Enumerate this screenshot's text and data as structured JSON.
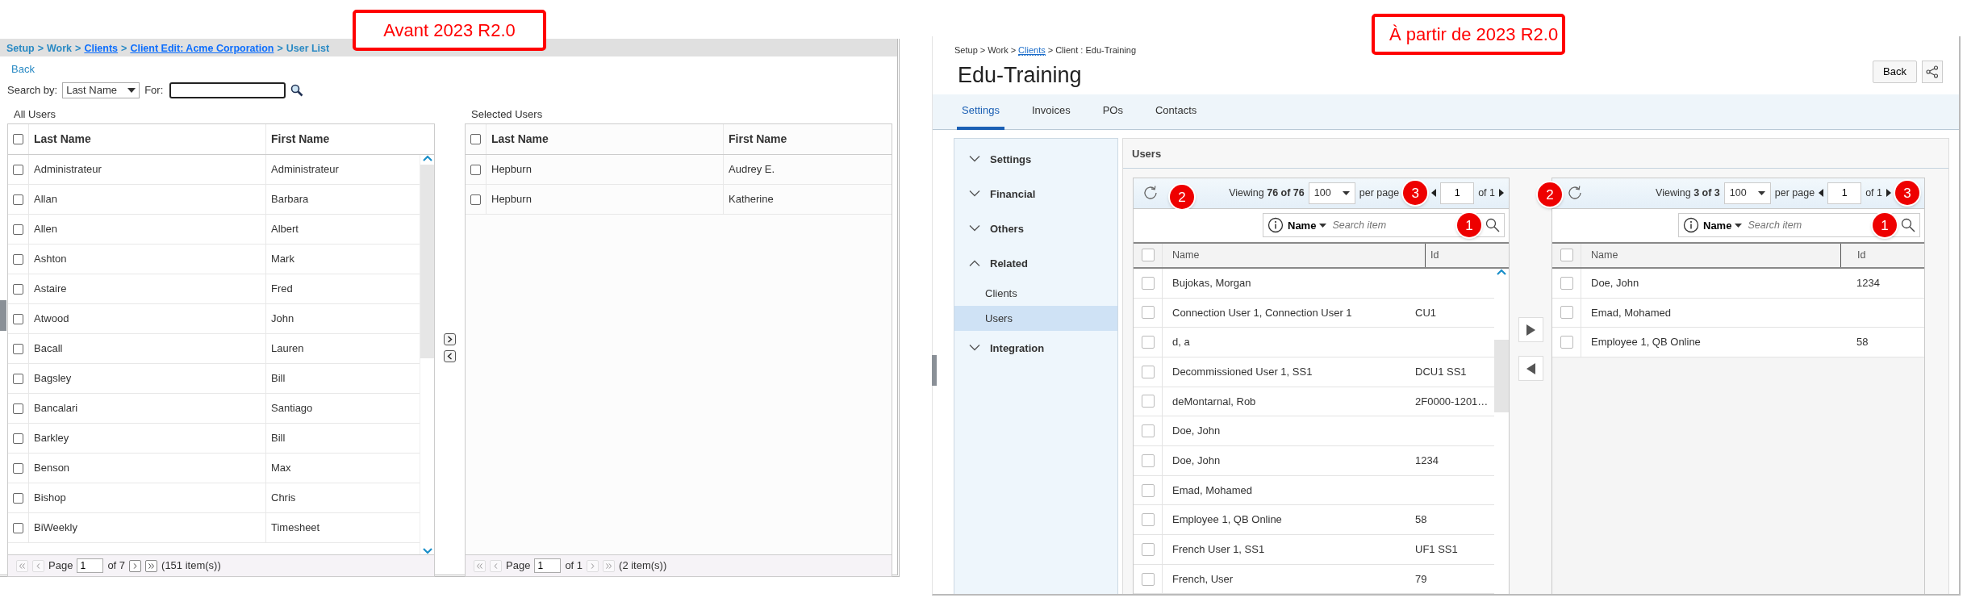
{
  "labels": [
    {
      "text": "Avant 2023 R2.0"
    },
    {
      "text": "À partir de 2023 R2.0"
    }
  ],
  "old": {
    "breadcrumb": {
      "separator": ">",
      "items": [
        {
          "text": "Setup",
          "link": false
        },
        {
          "text": "Work",
          "link": false
        },
        {
          "text": "Clients",
          "link": true
        },
        {
          "text": "Client Edit: Acme Corporation",
          "link": true
        },
        {
          "text": "User List",
          "link": false
        }
      ]
    },
    "back": "Back",
    "search": {
      "label": "Search by:",
      "field": "Last Name",
      "for_label": "For:"
    },
    "grids": [
      {
        "title": "All Users",
        "columns": [
          "Last Name",
          "First Name"
        ],
        "all_checked": false,
        "scrollbar": true,
        "rows": [
          {
            "last": "Administrateur",
            "first": "Administrateur",
            "checked": false
          },
          {
            "last": "Allan",
            "first": "Barbara",
            "checked": false
          },
          {
            "last": "Allen",
            "first": "Albert",
            "checked": false
          },
          {
            "last": "Ashton",
            "first": "Mark",
            "checked": false
          },
          {
            "last": "Astaire",
            "first": "Fred",
            "checked": false
          },
          {
            "last": "Atwood",
            "first": "John",
            "checked": false
          },
          {
            "last": "Bacall",
            "first": "Lauren",
            "checked": false
          },
          {
            "last": "Bagsley",
            "first": "Bill",
            "checked": false
          },
          {
            "last": "Bancalari",
            "first": "Santiago",
            "checked": false
          },
          {
            "last": "Barkley",
            "first": "Bill",
            "checked": false
          },
          {
            "last": "Benson",
            "first": "Max",
            "checked": false
          },
          {
            "last": "Bishop",
            "first": "Chris",
            "checked": false
          },
          {
            "last": "BiWeekly",
            "first": "Timesheet",
            "checked": false
          }
        ],
        "pager": {
          "page_label": "Page",
          "page": "1",
          "of": "of 7",
          "count": "(151 item(s))",
          "buttons": [
            {
              "kind": "first",
              "disabled": true
            },
            {
              "kind": "prev",
              "disabled": true
            },
            {
              "kind": "next",
              "disabled": false
            },
            {
              "kind": "last",
              "disabled": false
            }
          ]
        }
      },
      {
        "title": "Selected Users",
        "columns": [
          "Last Name",
          "First Name"
        ],
        "all_checked": false,
        "scrollbar": false,
        "rows": [
          {
            "last": "Hepburn",
            "first": "Audrey E.",
            "checked": false
          },
          {
            "last": "Hepburn",
            "first": "Katherine",
            "checked": false
          }
        ],
        "pager": {
          "page_label": "Page",
          "page": "1",
          "of": "of 1",
          "count": "(2 item(s))",
          "buttons": [
            {
              "kind": "first",
              "disabled": true
            },
            {
              "kind": "prev",
              "disabled": true
            },
            {
              "kind": "next",
              "disabled": true
            },
            {
              "kind": "last",
              "disabled": true
            }
          ]
        }
      }
    ]
  },
  "new": {
    "breadcrumb": {
      "separator": ">",
      "items": [
        {
          "text": "Setup",
          "link": false
        },
        {
          "text": "Work",
          "link": false
        },
        {
          "text": "Clients",
          "link": true
        },
        {
          "text": "Client : Edu-Training",
          "link": false
        }
      ]
    },
    "title": "Edu-Training",
    "back": "Back",
    "tabs": [
      {
        "label": "Settings",
        "selected": true
      },
      {
        "label": "Invoices",
        "selected": false
      },
      {
        "label": "POs",
        "selected": false
      },
      {
        "label": "Contacts",
        "selected": false
      }
    ],
    "sidebar": [
      {
        "label": "Settings",
        "expanded": false
      },
      {
        "label": "Financial",
        "expanded": false
      },
      {
        "label": "Others",
        "expanded": false
      },
      {
        "label": "Related",
        "expanded": true,
        "children": [
          {
            "label": "Clients",
            "selected": false
          },
          {
            "label": "Users",
            "selected": true
          }
        ]
      },
      {
        "label": "Integration",
        "expanded": false
      }
    ],
    "panel_title": "Users",
    "grids": [
      {
        "viewing": "Viewing **76 of 76**",
        "per_page": "100",
        "per_page_label": "per page",
        "page": "1",
        "of": "of 1",
        "filter": "Name",
        "placeholder": "Search item",
        "columns": [
          "Name",
          "Id"
        ],
        "all_checked": false,
        "scrollbar": true,
        "refresh_marker": {
          "text": "2",
          "before": false
        },
        "pager_marker": {
          "text": "3",
          "at_end": false
        },
        "search_marker": {
          "text": "1"
        },
        "rows": [
          {
            "name": "Bujokas, Morgan",
            "checked": false
          },
          {
            "name": "Connection User 1, Connection User 1",
            "id": "CU1",
            "checked": false
          },
          {
            "name": "d, a",
            "checked": false
          },
          {
            "name": "Decommissioned User 1, SS1",
            "id": "DCU1 SS1",
            "checked": false
          },
          {
            "name": "deMontarnal, Rob",
            "id": "2F0000-1201…",
            "checked": false
          },
          {
            "name": "Doe, John",
            "checked": false
          },
          {
            "name": "Doe, John",
            "id": "1234",
            "checked": false
          },
          {
            "name": "Emad, Mohamed",
            "checked": false
          },
          {
            "name": "Employee 1, QB Online",
            "id": "58",
            "checked": false
          },
          {
            "name": "French User 1, SS1",
            "id": "UF1 SS1",
            "checked": false
          },
          {
            "name": "French, User",
            "id": "79",
            "checked": false
          }
        ]
      },
      {
        "viewing": "Viewing **3 of 3**",
        "per_page": "100",
        "per_page_label": "per page",
        "page": "1",
        "of": "of 1",
        "filter": "Name",
        "placeholder": "Search item",
        "columns": [
          "Name",
          "Id"
        ],
        "all_checked": false,
        "scrollbar": false,
        "refresh_marker": {
          "text": "2",
          "before": true
        },
        "pager_marker": {
          "text": "3",
          "at_end": true
        },
        "search_marker": {
          "text": "1"
        },
        "rows": [
          {
            "name": "Doe, John",
            "id": "1234",
            "checked": false
          },
          {
            "name": "Emad, Mohamed",
            "checked": false
          },
          {
            "name": "Employee 1, QB Online",
            "id": "58",
            "checked": false
          }
        ]
      }
    ]
  }
}
